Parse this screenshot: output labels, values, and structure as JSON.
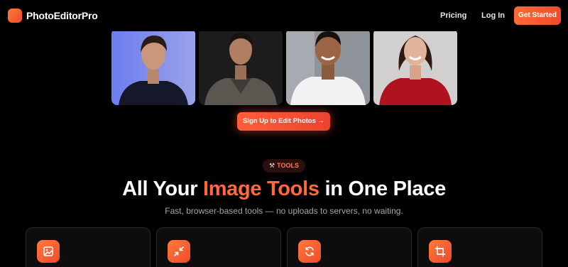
{
  "nav": {
    "brand": "PhotoEditorPro",
    "links": [
      "Pricing",
      "Log In"
    ],
    "cta": "Get Started"
  },
  "hero": {
    "cta": "Sign Up to Edit Photos →"
  },
  "tools": {
    "badge": "TOOLS",
    "badge_icon": "⚒",
    "headline_pre": "All Your ",
    "headline_accent": "Image Tools",
    "headline_post": " in One Place",
    "subhead": "Fast, browser-based tools — no uploads to servers, no waiting.",
    "cards": [
      {
        "icon": "image-icon"
      },
      {
        "icon": "compress-icon"
      },
      {
        "icon": "rotate-icon"
      },
      {
        "icon": "crop-icon"
      }
    ]
  },
  "colors": {
    "accent": "#ff6a3d",
    "background": "#000000"
  }
}
